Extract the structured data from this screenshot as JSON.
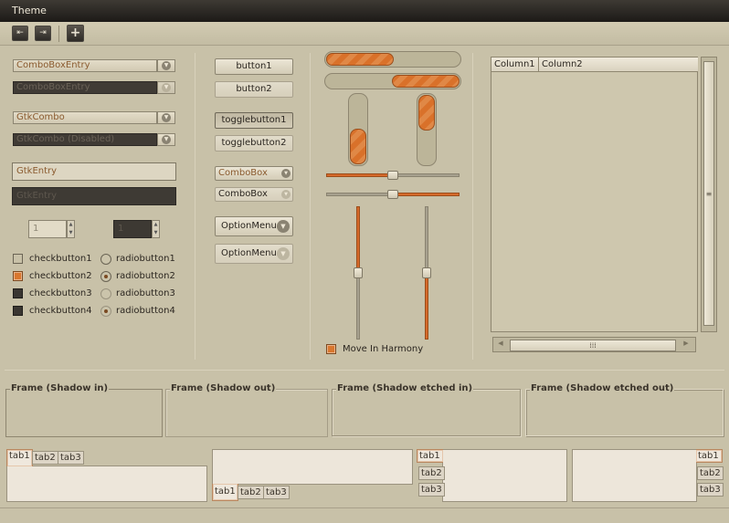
{
  "window": {
    "title": "Theme"
  },
  "toolbar": {
    "buttons": [
      {
        "name": "goto-first-icon",
        "glyph": "⇤"
      },
      {
        "name": "goto-last-icon",
        "glyph": "⇥"
      },
      {
        "name": "add-icon",
        "glyph": "+"
      }
    ]
  },
  "combos": {
    "combobox_entry": "ComboBoxEntry",
    "combobox_entry_disabled": "ComboBoxEntry",
    "gtkcombo": "GtkCombo",
    "gtkcombo_disabled": "GtkCombo (Disabled)"
  },
  "entries": {
    "entry": "GtkEntry",
    "entry_disabled": "GtkEntry"
  },
  "spins": {
    "spin1": "1",
    "spin2": "1"
  },
  "checks": [
    {
      "label": "checkbutton1",
      "state": "unchecked"
    },
    {
      "label": "checkbutton2",
      "state": "checked"
    },
    {
      "label": "checkbutton3",
      "state": "dark"
    },
    {
      "label": "checkbutton4",
      "state": "dark"
    }
  ],
  "radios": [
    {
      "label": "radiobutton1",
      "selected": false
    },
    {
      "label": "radiobutton2",
      "selected": true
    },
    {
      "label": "radiobutton3",
      "selected": false
    },
    {
      "label": "radiobutton4",
      "selected": true
    }
  ],
  "buttons": {
    "button1": "button1",
    "button2": "button2",
    "toggle1": "togglebutton1",
    "toggle2": "togglebutton2",
    "combobox1": "ComboBox",
    "combobox2": "ComboBox",
    "optionmenu1": "OptionMenu",
    "optionmenu2": "OptionMenu"
  },
  "progress": {
    "horizontal": [
      {
        "fraction": 0.5,
        "from": "left"
      },
      {
        "fraction": 0.5,
        "from": "right"
      }
    ],
    "vertical": [
      {
        "fraction": 0.5,
        "from": "bottom"
      },
      {
        "fraction": 0.5,
        "from": "top"
      }
    ]
  },
  "scales": {
    "hscale_1": {
      "value": 0.5,
      "filled": "left"
    },
    "hscale_2": {
      "value": 0.5,
      "filled": "right"
    },
    "vscale_1": {
      "value": 0.5,
      "filled": "top"
    },
    "vscale_2": {
      "value": 0.5,
      "filled": "bottom"
    },
    "harmony_label": "Move In Harmony",
    "harmony_checked": true
  },
  "tree": {
    "columns": [
      "Column1",
      "Column2"
    ]
  },
  "frames": [
    {
      "label": "Frame (Shadow in)",
      "style": "in"
    },
    {
      "label": "Frame (Shadow out)",
      "style": "out"
    },
    {
      "label": "Frame (Shadow etched in)",
      "style": "etched-in"
    },
    {
      "label": "Frame (Shadow etched out)",
      "style": "etched-out"
    }
  ],
  "notebooks": {
    "tabs": [
      "tab1",
      "tab2",
      "tab3"
    ],
    "active": "tab1",
    "positions": [
      "top",
      "bottom",
      "left",
      "right"
    ]
  },
  "colors": {
    "accent": "#d9712a",
    "background": "#c8c1a8",
    "titlebar": "#2a2723"
  }
}
